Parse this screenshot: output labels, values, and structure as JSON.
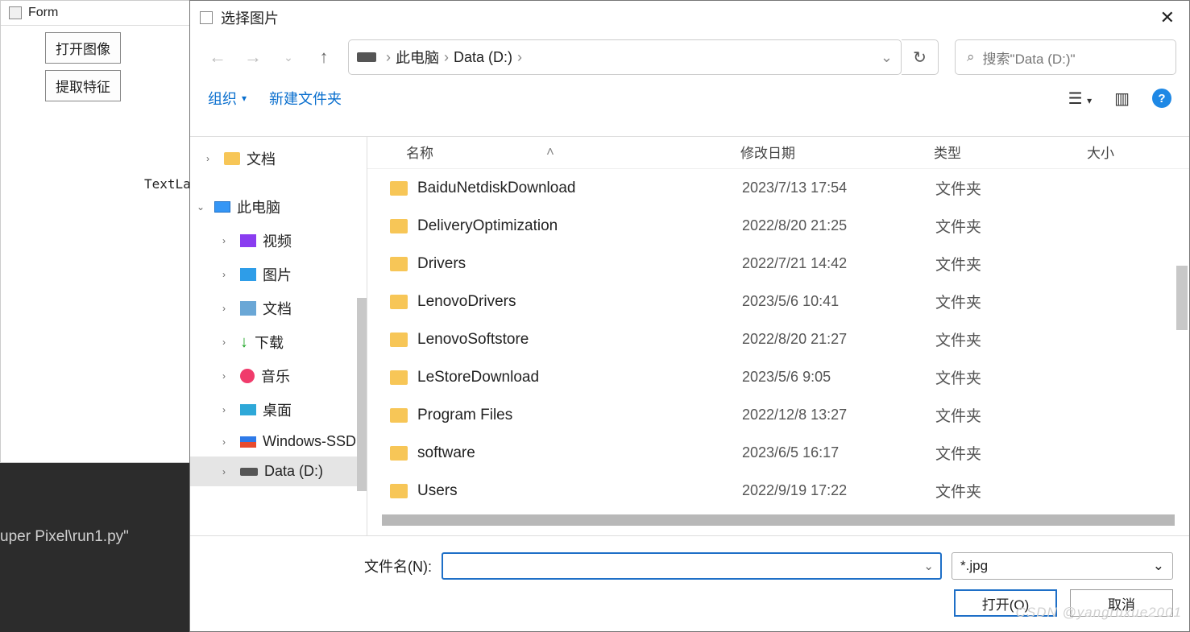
{
  "bg_window": {
    "title": "Form",
    "open_image": "打开图像",
    "extract_feat": "提取特征",
    "text_label": "TextLa"
  },
  "terminal_line": "uper Pixel\\run1.py\"",
  "dialog": {
    "title": "选择图片",
    "breadcrumb": {
      "pc": "此电脑",
      "drive": "Data (D:)"
    },
    "search_placeholder": "搜索\"Data (D:)\"",
    "toolbar": {
      "organize": "组织",
      "new_folder": "新建文件夹"
    },
    "tree": {
      "documents_top": "文档",
      "this_pc": "此电脑",
      "video": "视频",
      "images": "图片",
      "documents": "文档",
      "downloads": "下载",
      "music": "音乐",
      "desktop": "桌面",
      "ssd": "Windows-SSD",
      "data": "Data (D:)"
    },
    "columns": {
      "name": "名称",
      "date": "修改日期",
      "type": "类型",
      "size": "大小"
    },
    "rows": [
      {
        "name": "BaiduNetdiskDownload",
        "date": "2023/7/13 17:54",
        "type": "文件夹"
      },
      {
        "name": "DeliveryOptimization",
        "date": "2022/8/20 21:25",
        "type": "文件夹"
      },
      {
        "name": "Drivers",
        "date": "2022/7/21 14:42",
        "type": "文件夹"
      },
      {
        "name": "LenovoDrivers",
        "date": "2023/5/6 10:41",
        "type": "文件夹"
      },
      {
        "name": "LenovoSoftstore",
        "date": "2022/8/20 21:27",
        "type": "文件夹"
      },
      {
        "name": "LeStoreDownload",
        "date": "2023/5/6 9:05",
        "type": "文件夹"
      },
      {
        "name": "Program Files",
        "date": "2022/12/8 13:27",
        "type": "文件夹"
      },
      {
        "name": "software",
        "date": "2023/6/5 16:17",
        "type": "文件夹"
      },
      {
        "name": "Users",
        "date": "2022/9/19 17:22",
        "type": "文件夹"
      }
    ],
    "filename_label": "文件名(N):",
    "filter": "*.jpg",
    "open_btn": "打开(O)",
    "cancel_btn": "取消"
  },
  "watermark": "CSDN @yangruxue2001"
}
